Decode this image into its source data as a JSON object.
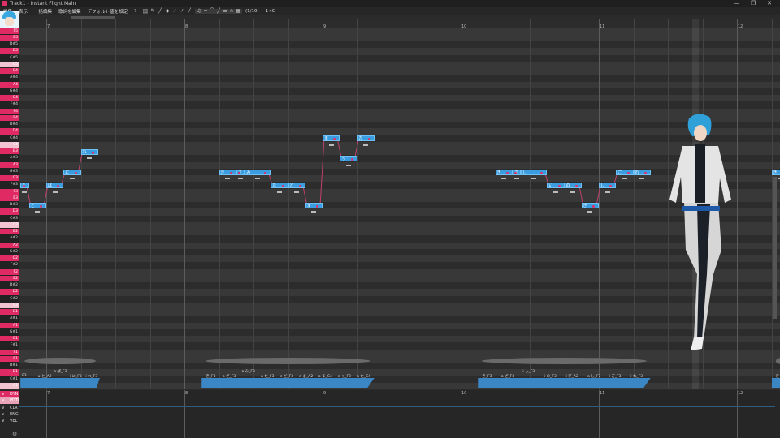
{
  "window": {
    "title": "Track1 - Instant Flight Main",
    "min": "—",
    "max": "❐",
    "close": "✕"
  },
  "menu": [
    "編集",
    "表示",
    "一括編集",
    "歌詞を編集",
    "デフォルト値を設定",
    "?"
  ],
  "toolbar": {
    "page": "(1/10)",
    "key": "1<C"
  },
  "measures": [
    "7",
    "8",
    "9",
    "10",
    "11",
    "12"
  ],
  "keyboard": {
    "keys": [
      "F#5",
      "F5",
      "E5",
      "D#5",
      "D5",
      "C#5",
      "C5",
      "B4",
      "A#4",
      "A4",
      "G#4",
      "G4",
      "F#4",
      "F4",
      "E4",
      "D#4",
      "D4",
      "C#4",
      "C4",
      "B3",
      "A#3",
      "A3",
      "G#3",
      "G3",
      "F#3",
      "F3",
      "E3",
      "D#3",
      "D3",
      "C#3",
      "C3",
      "B2",
      "A#2",
      "A2",
      "G#2",
      "G2",
      "F#2",
      "F2",
      "E2",
      "D#2",
      "D2",
      "C#2",
      "C2",
      "B1",
      "A#1",
      "A1",
      "G#1",
      "G1",
      "F#1",
      "F1",
      "E1",
      "D#1",
      "D1",
      "C#1",
      "C1"
    ]
  },
  "notes": [
    {
      "pitch": "F#3",
      "start": -0.75,
      "len": 0.25,
      "lyric": "と"
    },
    {
      "pitch": "D#3",
      "start": -0.5,
      "len": 0.5,
      "lyric": "と"
    },
    {
      "pitch": "F#3",
      "start": 0,
      "len": 0.5,
      "lyric": "ぱ"
    },
    {
      "pitch": "G#3",
      "start": 0.5,
      "len": 0.5,
      "lyric": "に"
    },
    {
      "pitch": "B3",
      "start": 1,
      "len": 0.5,
      "lyric": "れ"
    },
    {
      "pitch": "G#3",
      "start": 5,
      "len": 0.5,
      "lyric": "き"
    },
    {
      "pitch": "G#3",
      "start": 5.5,
      "len": 0.25,
      "lyric": "ざ"
    },
    {
      "pitch": "G#3",
      "start": 5.75,
      "len": 0.75,
      "lyric": "み"
    },
    {
      "pitch": "F#3",
      "start": 6.5,
      "len": 0.5,
      "lyric": "た"
    },
    {
      "pitch": "F#3",
      "start": 7,
      "len": 0.5,
      "lyric": "ど"
    },
    {
      "pitch": "D#3",
      "start": 7.5,
      "len": 0.5,
      "lyric": "ま"
    },
    {
      "pitch": "C#4",
      "start": 8,
      "len": 0.5,
      "lyric": "ま"
    },
    {
      "pitch": "A#3",
      "start": 8.5,
      "len": 0.5,
      "lyric": "っ"
    },
    {
      "pitch": "C#4",
      "start": 9,
      "len": 0.5,
      "lyric": "た"
    },
    {
      "pitch": "G#3",
      "start": 13,
      "len": 0.5,
      "lyric": "き"
    },
    {
      "pitch": "G#3",
      "start": 13.5,
      "len": 0.25,
      "lyric": "ざ"
    },
    {
      "pitch": "G#3",
      "start": 13.75,
      "len": 0.75,
      "lyric": "し"
    },
    {
      "pitch": "F#3",
      "start": 14.5,
      "len": 0.5,
      "lyric": "い"
    },
    {
      "pitch": "F#3",
      "start": 15,
      "len": 0.5,
      "lyric": "の"
    },
    {
      "pitch": "D#3",
      "start": 15.5,
      "len": 0.5,
      "lyric": "ぎ"
    },
    {
      "pitch": "F#3",
      "start": 16,
      "len": 0.5,
      "lyric": "し"
    },
    {
      "pitch": "G#3",
      "start": 16.5,
      "len": 0.5,
      "lyric": "ご"
    },
    {
      "pitch": "G#3",
      "start": 17,
      "len": 0.5,
      "lyric": "れ"
    },
    {
      "pitch": "G#3",
      "start": 21,
      "len": 0.5,
      "lyric": "き"
    }
  ],
  "phonemes": [
    {
      "start": -0.75,
      "len": 2.3,
      "labels": [
        "F3",
        "u と_A2",
        "a ぱ_F3",
        "i に_F3",
        "i れ_F3"
      ]
    },
    {
      "start": 4.5,
      "len": 5.0,
      "labels": [
        "- き_F3",
        "a ざ_F3",
        "o み_F3",
        "a た_F3",
        "e ど_F3",
        "a ま_A2",
        "a ま_C4",
        "e っ_F3",
        "a た_C4"
      ]
    },
    {
      "start": 12.5,
      "len": 5.0,
      "labels": [
        "- き_F3",
        "a ざ_F3",
        "i し_F3",
        "i の_F3",
        "i ぎ_A2",
        "a し_F3",
        "i ご_F3",
        "i れ_F3"
      ]
    },
    {
      "start": 21,
      "len": 0.6,
      "labels": [
        "- き"
      ]
    }
  ],
  "controls": [
    "DYN",
    "PITD",
    "CLR",
    "ENG",
    "VEL"
  ],
  "colors": {
    "accent": "#e02a64",
    "note": "#3b9de0"
  }
}
